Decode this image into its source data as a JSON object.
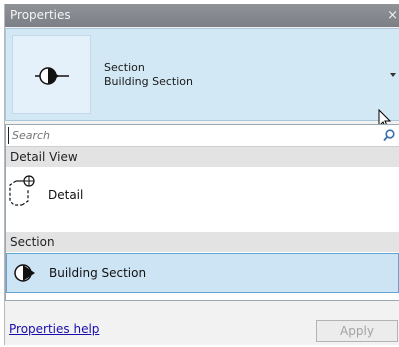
{
  "window": {
    "title": "Properties",
    "close_glyph": "×"
  },
  "type_selector": {
    "family": "Section",
    "type": "Building Section",
    "icon": "section-marker-icon"
  },
  "search": {
    "placeholder": "Search"
  },
  "groups": [
    {
      "label": "Detail View",
      "items": [
        {
          "label": "Detail",
          "icon": "detail-callout-icon"
        }
      ]
    },
    {
      "label": "Section",
      "items": [
        {
          "label": "Building Section",
          "icon": "section-marker-icon",
          "selected": true
        }
      ]
    }
  ],
  "footer": {
    "help_link": "Properties help",
    "apply_label": "Apply"
  },
  "colors": {
    "selector_background": "#d3e8f5",
    "selected_item_background": "#cde4f5",
    "selected_item_border": "#62a3d3",
    "link": "#1a0dab"
  }
}
